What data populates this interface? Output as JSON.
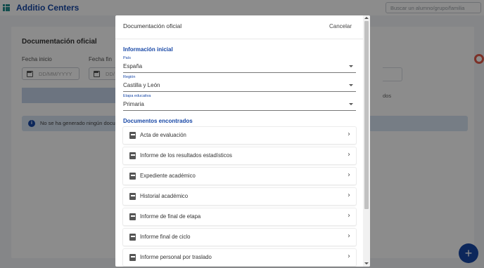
{
  "app": {
    "brand": "Additio Centers",
    "search_placeholder": "Buscar un alumno/grupo/familia"
  },
  "background": {
    "title": "Documentación oficial",
    "start_label": "Fecha inicio",
    "end_label": "Fecha fin",
    "date_placeholder": "DD/MM/YYYY",
    "date_placeholder_cut": "DD/",
    "right_fragment": "dos",
    "info_text": "No se ha generado ningún documento",
    "fab_label": "+"
  },
  "dialog": {
    "title": "Documentación oficial",
    "cancel_label": "Cancelar",
    "section_initial": "Información inicial",
    "fields": [
      {
        "label": "País",
        "value": "España"
      },
      {
        "label": "Región",
        "value": "Castilla y León"
      },
      {
        "label": "Etapa educativa",
        "value": "Primaria"
      }
    ],
    "section_docs": "Documentos encontrados",
    "documents": [
      "Acta de evaluación",
      "Informe de los resultados estadísticos",
      "Expediente académico",
      "Historial académico",
      "Informe de final de etapa",
      "Informe final de ciclo",
      "Informe personal por traslado"
    ],
    "icons": {
      "document": "pdf-file-icon",
      "open": "chevron-right-icon"
    }
  },
  "colors": {
    "brand": "#1747a6",
    "accent": "#1e8a8a"
  }
}
